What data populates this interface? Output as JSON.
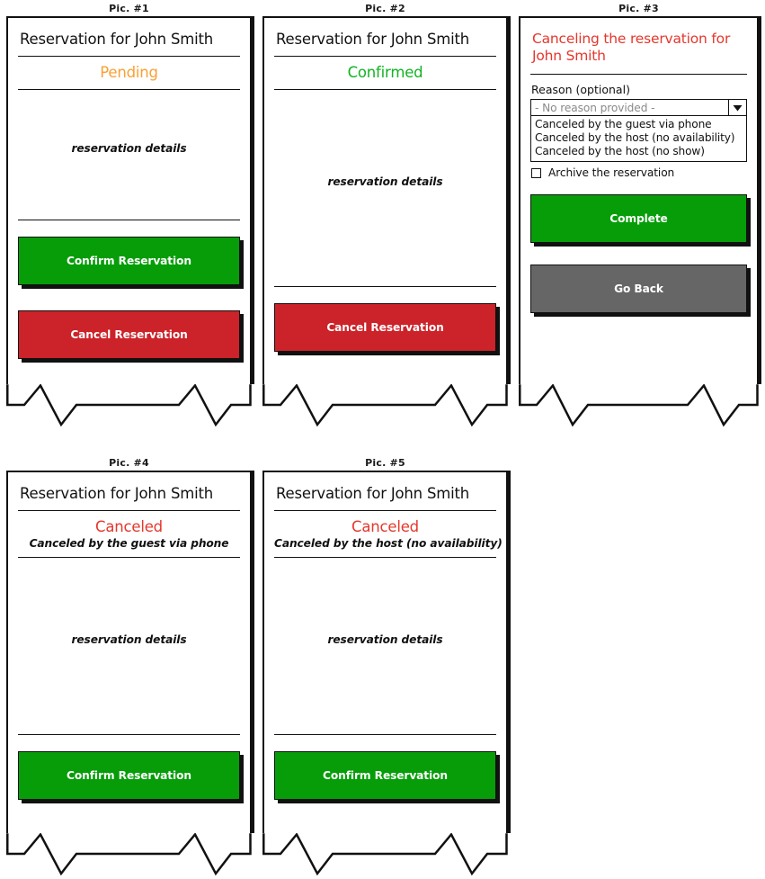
{
  "palette": {
    "ink": "#111111",
    "pending": "#FBA033",
    "confirmed": "#11B321",
    "canceled": "#E5372C",
    "button_green": "#069D09",
    "button_red": "#CC2229",
    "button_grey": "#666666",
    "placeholder_grey": "#8A8A8A",
    "paper": "#FFFFFF"
  },
  "pics": [
    {
      "label": "Pic. #1",
      "title": "Reservation for John Smith",
      "status": "Pending",
      "details": "reservation details",
      "buttons": [
        {
          "label": "Confirm Reservation",
          "color": "green"
        },
        {
          "label": "Cancel Reservation",
          "color": "red"
        }
      ]
    },
    {
      "label": "Pic. #2",
      "title": "Reservation for John Smith",
      "status": "Confirmed",
      "details": "reservation details",
      "buttons": [
        {
          "label": "Cancel Reservation",
          "color": "red"
        }
      ]
    },
    {
      "label": "Pic. #3",
      "title": "Canceling the reservation for John Smith",
      "field_label": "Reason (optional)",
      "select_value": "- No reason provided -",
      "select_icon": "chevron-down-icon",
      "options": [
        "Canceled by the guest via phone",
        "Canceled by the host (no availability)",
        "Canceled by the host (no show)"
      ],
      "checkbox_label": "Archive the reservation",
      "checkbox_checked": false,
      "buttons": [
        {
          "label": "Complete",
          "color": "green"
        },
        {
          "label": "Go Back",
          "color": "grey"
        }
      ]
    },
    {
      "label": "Pic. #4",
      "title": "Reservation for John Smith",
      "status": "Canceled",
      "status_reason": "Canceled by the guest via phone",
      "details": "reservation details",
      "buttons": [
        {
          "label": "Confirm Reservation",
          "color": "green"
        }
      ]
    },
    {
      "label": "Pic. #5",
      "title": "Reservation for John Smith",
      "status": "Canceled",
      "status_reason": "Canceled by the host (no availability)",
      "details": "reservation details",
      "buttons": [
        {
          "label": "Confirm Reservation",
          "color": "green"
        }
      ]
    }
  ]
}
